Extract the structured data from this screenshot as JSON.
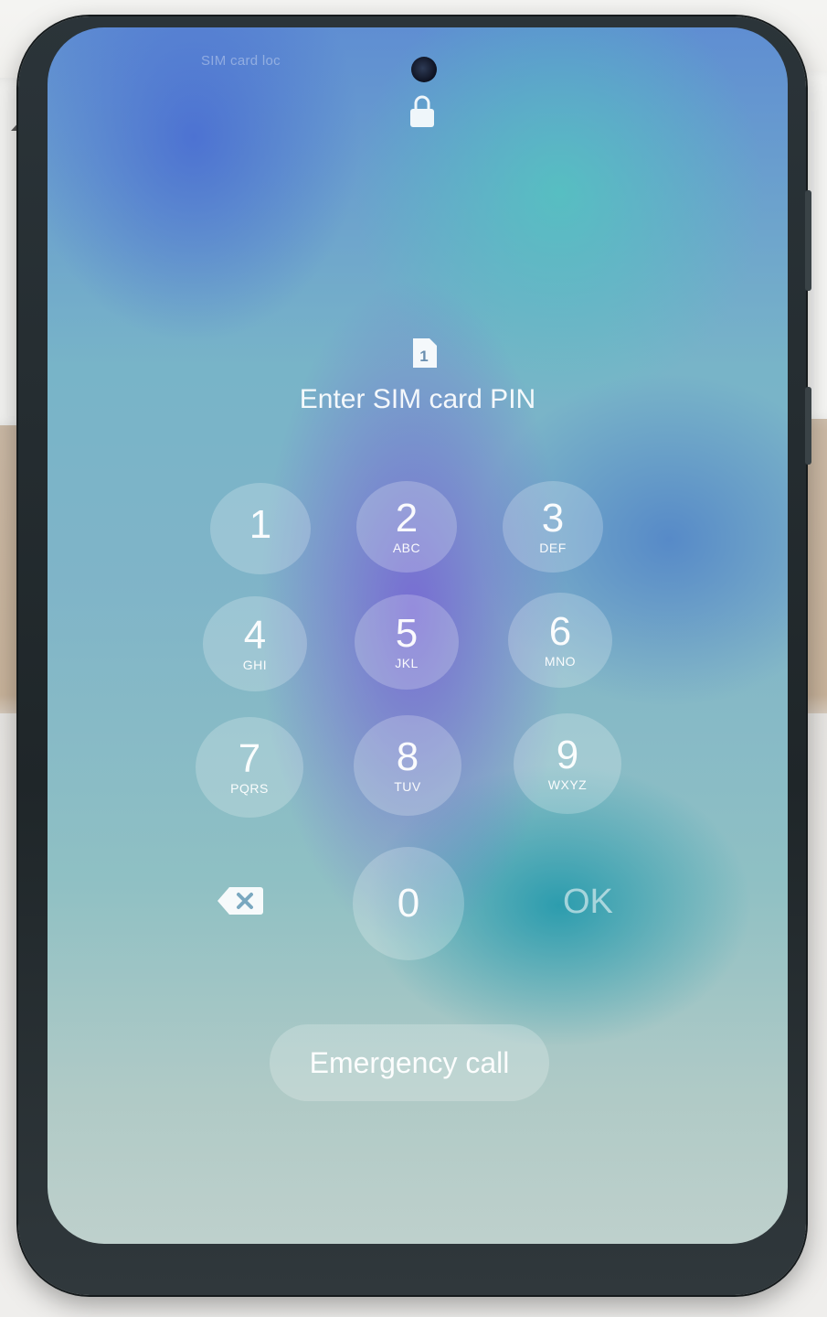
{
  "status_bar": {
    "text": "SIM card loc"
  },
  "lock_screen": {
    "sim_slot": "1",
    "title": "Enter SIM card PIN"
  },
  "keypad": {
    "keys": [
      {
        "digit": "1",
        "letters": ""
      },
      {
        "digit": "2",
        "letters": "ABC"
      },
      {
        "digit": "3",
        "letters": "DEF"
      },
      {
        "digit": "4",
        "letters": "GHI"
      },
      {
        "digit": "5",
        "letters": "JKL"
      },
      {
        "digit": "6",
        "letters": "MNO"
      },
      {
        "digit": "7",
        "letters": "PQRS"
      },
      {
        "digit": "8",
        "letters": "TUV"
      },
      {
        "digit": "9",
        "letters": "WXYZ"
      },
      {
        "digit": "0",
        "letters": ""
      }
    ],
    "ok_label": "OK"
  },
  "emergency_call_label": "Emergency call",
  "icons": {
    "lock": "lock-icon",
    "sim": "sim-card-icon",
    "backspace": "backspace-icon"
  }
}
